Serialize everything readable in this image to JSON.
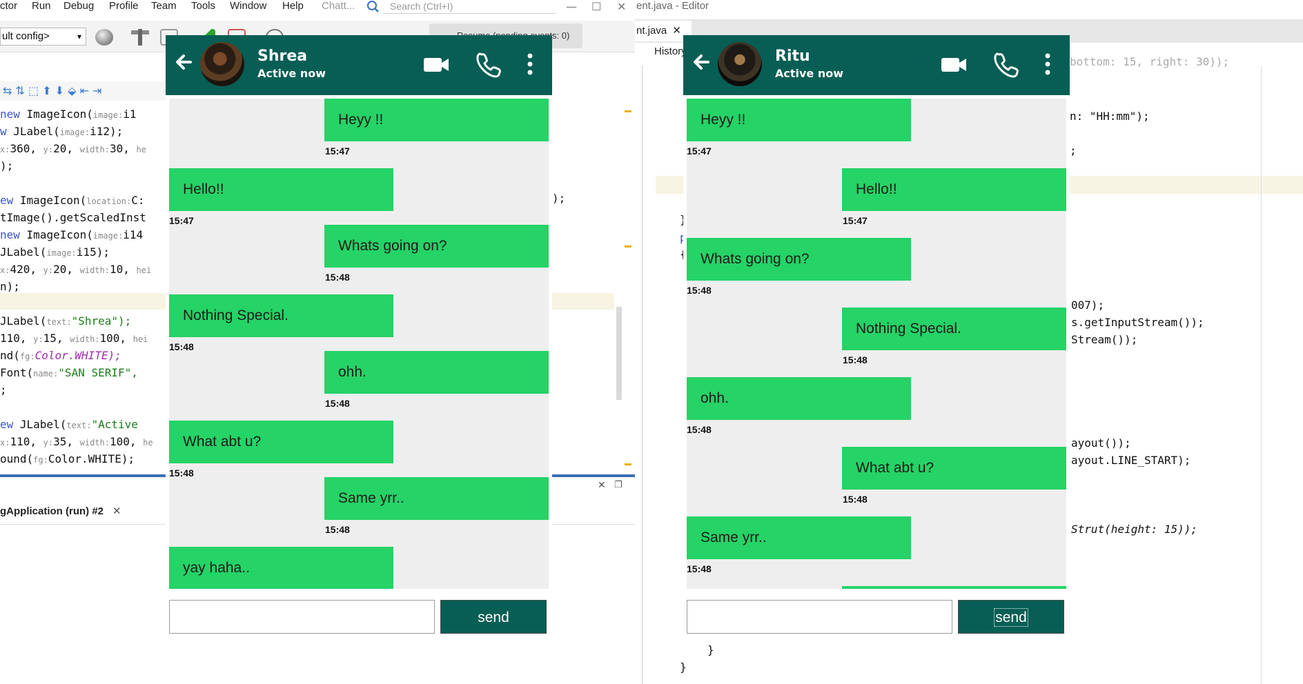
{
  "ide_left": {
    "menu": [
      "ctor",
      "Run",
      "Debug",
      "Profile",
      "Team",
      "Tools",
      "Window",
      "Help",
      "Chatt..."
    ],
    "search_placeholder": "Search (Ctrl+I)",
    "window_controls": [
      "—",
      "☐",
      "✕"
    ],
    "config_select": "ult config>",
    "progress_text": "Resume (pending events: 0)",
    "code_lines": [
      {
        "pre_kw": "new",
        "text": " ImageIcon(",
        "hint": "image:",
        "tail": "i1"
      },
      {
        "pre_kw": "w",
        "text": " JLabel(",
        "hint": "image:",
        "tail": "i12);"
      },
      {
        "pre_kw": "",
        "text": " ",
        "hint": "x:",
        "tail": "360,",
        "hint2": "y:",
        "tail2": "20,",
        "hint3": "width:",
        "tail3": "30,",
        "hint4": "he",
        "tail4": ""
      },
      {
        "pre_kw": "",
        "text": ");",
        "hint": "",
        "tail": ""
      },
      {
        "pre_kw": "",
        "text": "",
        "hint": "",
        "tail": ""
      },
      {
        "pre_kw": "ew",
        "text": " ImageIcon(",
        "hint": "location:",
        "tail": "C:"
      },
      {
        "pre_kw": "",
        "text": "tImage().getScaledInst",
        "hint": "",
        "tail": ""
      },
      {
        "pre_kw": "new",
        "text": " ImageIcon(",
        "hint": "image:",
        "tail": "i14"
      },
      {
        "pre_kw": "",
        "text": " JLabel(",
        "hint": "image:",
        "tail": "i15);"
      },
      {
        "pre_kw": "",
        "text": "x:",
        "hint": "",
        "tail": "420,",
        "hint2": "y:",
        "tail2": "20,",
        "hint3": "width:",
        "tail3": "10,",
        "hint4": "hei",
        "tail4": ""
      },
      {
        "pre_kw": "",
        "text": "n);",
        "hint": "",
        "tail": ""
      },
      {
        "pre_kw": "",
        "text": "",
        "hint": "",
        "tail": ""
      },
      {
        "pre_kw": "",
        "text": " JLabel(",
        "hint": "text:",
        "tail": "\"Shrea\");"
      },
      {
        "pre_kw": "",
        "text": " 110,",
        "hint": "y:",
        "tail": "15,",
        "hint2": "width:",
        "tail2": "100,",
        "hint3": "hei",
        "tail3": ""
      },
      {
        "pre_kw": "",
        "text": "nd(",
        "hint": "fg:",
        "tail": "Color.WHITE);"
      },
      {
        "pre_kw": "",
        "text": " Font(",
        "hint": "name:",
        "tail": "\"SAN SERIF\","
      },
      {
        "pre_kw": "",
        "text": ";",
        "hint": "",
        "tail": ""
      },
      {
        "pre_kw": "",
        "text": "",
        "hint": "",
        "tail": ""
      },
      {
        "pre_kw": "ew",
        "text": " JLabel(",
        "hint": "text:",
        "tail": "\"Active"
      },
      {
        "pre_kw": "",
        "text": "x:",
        "hint": "",
        "tail": "110,",
        "hint2": "y:",
        "tail2": "35,",
        "hint3": "width:",
        "tail3": "100,",
        "hint4": "he",
        "tail4": ""
      },
      {
        "pre_kw": "",
        "text": "ound(",
        "hint": "fg:",
        "tail": "Color.WHITE);"
      }
    ],
    "code_right_fragment": ");",
    "output_tab": "gApplication (run) #2",
    "output_tab_close": "✕"
  },
  "ide_right": {
    "title": "ent.java - Editor",
    "tab": "nt.java",
    "tab_close": "✕",
    "history": "History",
    "code_lines": [
      "bottom: 15, right: 30));",
      "n: \"HH:mm\");",
      ";",
      "}",
      "p",
      "{",
      "007);",
      "s.getInputStream());",
      "Stream());",
      "ayout());",
      "ayout.LINE_START);",
      "Strut(height: 15));",
      "}",
      "}"
    ]
  },
  "chat_shrea": {
    "name": "Shrea",
    "status": "Active now",
    "icons": [
      "back-arrow-icon",
      "video-call-icon",
      "phone-icon",
      "more-vert-icon"
    ],
    "messages": [
      {
        "text": "Heyy !!",
        "time": "15:47",
        "side": "right"
      },
      {
        "text": "Hello!!",
        "time": "15:47",
        "side": "left"
      },
      {
        "text": "Whats going on?",
        "time": "15:48",
        "side": "right"
      },
      {
        "text": "Nothing Special.",
        "time": "15:48",
        "side": "left"
      },
      {
        "text": "ohh.",
        "time": "15:48",
        "side": "right"
      },
      {
        "text": "What abt u?",
        "time": "15:48",
        "side": "left"
      },
      {
        "text": "Same yrr..",
        "time": "15:48",
        "side": "right"
      },
      {
        "text": "yay haha..",
        "time": "",
        "side": "left"
      }
    ],
    "input_value": "",
    "send_label": "send"
  },
  "chat_ritu": {
    "name": "Ritu",
    "status": "Active now",
    "icons": [
      "back-arrow-icon",
      "video-call-icon",
      "phone-icon",
      "more-vert-icon"
    ],
    "messages": [
      {
        "text": "Heyy !!",
        "time": "15:47",
        "side": "left"
      },
      {
        "text": "Hello!!",
        "time": "15:47",
        "side": "right"
      },
      {
        "text": "Whats going on?",
        "time": "15:48",
        "side": "left"
      },
      {
        "text": "Nothing Special.",
        "time": "15:48",
        "side": "right"
      },
      {
        "text": "ohh.",
        "time": "15:48",
        "side": "left"
      },
      {
        "text": "What abt u?",
        "time": "15:48",
        "side": "right"
      },
      {
        "text": "Same yrr..",
        "time": "15:48",
        "side": "left"
      }
    ],
    "input_value": "",
    "send_label": "send"
  },
  "colors": {
    "header": "#075e54",
    "bubble": "#25d366",
    "chat_bg": "#eeeeee"
  }
}
